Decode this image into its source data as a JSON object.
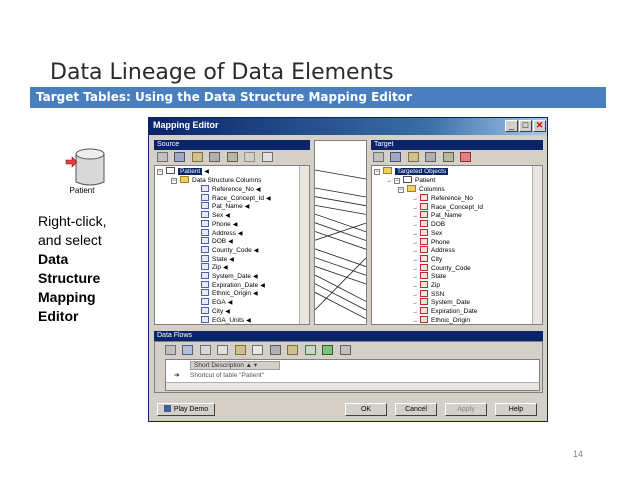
{
  "slide": {
    "title": "Data Lineage of Data Elements",
    "subtitle": "Target Tables: Using the Data Structure Mapping Editor",
    "page_number": "14"
  },
  "patient_icon_label": "Patient",
  "instructions": {
    "line1": "Right-click,",
    "line2": "and select",
    "bold_lines": [
      "Data",
      "Structure",
      "Mapping",
      "Editor"
    ]
  },
  "window": {
    "title": "Mapping Editor",
    "source": {
      "header": "Source",
      "root": "Patient",
      "group": "Data Structure Columns",
      "columns": [
        "Reference_No",
        "Race_Concept_Id",
        "Pat_Name",
        "Sex",
        "Phone",
        "Address",
        "DOB",
        "County_Code",
        "State",
        "Zip",
        "System_Date",
        "Expiration_Date",
        "Ethnic_Origin",
        "EGA",
        "City",
        "EGA_Units"
      ]
    },
    "target": {
      "header": "Target",
      "root": "Targeted Objects",
      "table": "Patient",
      "group": "Columns",
      "columns": [
        "Reference_No",
        "Race_Concept_Id",
        "Pat_Name",
        "DOB",
        "Sex",
        "Phone",
        "Address",
        "City",
        "County_Code",
        "State",
        "Zip",
        "SSN",
        "System_Date",
        "Expiration_Date",
        "Ethnic_Origin"
      ]
    },
    "data_flows": {
      "header": "Data Flows",
      "column_header": "Short Description",
      "row_value": "Shortcut of table \"Patient\""
    },
    "buttons": {
      "play_demo": "Play Demo",
      "ok": "OK",
      "cancel": "Cancel",
      "apply": "Apply",
      "help": "Help"
    }
  }
}
